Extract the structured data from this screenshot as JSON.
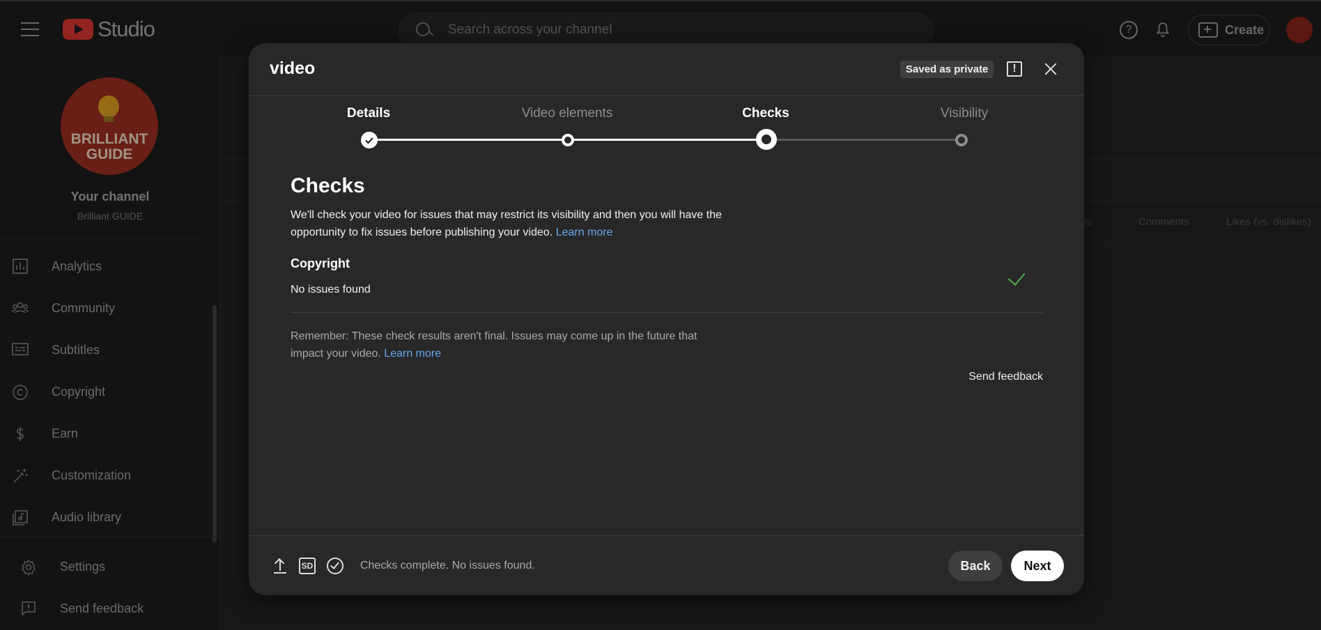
{
  "app": {
    "brand": "Studio",
    "search_placeholder": "Search across your channel",
    "create_label": "Create"
  },
  "sidebar": {
    "avatar_text": "BRILLIANT GUIDE",
    "your_channel": "Your channel",
    "channel_name": "Brilliant GUIDE",
    "items": [
      {
        "label": "Analytics",
        "icon": "analytics-icon"
      },
      {
        "label": "Community",
        "icon": "community-icon"
      },
      {
        "label": "Subtitles",
        "icon": "subtitles-icon"
      },
      {
        "label": "Copyright",
        "icon": "copyright-icon"
      },
      {
        "label": "Earn",
        "icon": "earn-icon"
      },
      {
        "label": "Customization",
        "icon": "customization-icon"
      },
      {
        "label": "Audio library",
        "icon": "audio-library-icon"
      }
    ],
    "settings_label": "Settings",
    "send_feedback_label": "Send feedback"
  },
  "background_columns": [
    "ews",
    "Comments",
    "Likes (vs. dislikes)"
  ],
  "dialog": {
    "title": "video",
    "saved_badge": "Saved as private",
    "steps": [
      {
        "label": "Details",
        "state": "done"
      },
      {
        "label": "Video elements",
        "state": "done"
      },
      {
        "label": "Checks",
        "state": "current"
      },
      {
        "label": "Visibility",
        "state": "todo"
      }
    ],
    "content_title": "Checks",
    "content_desc": "We'll check your video for issues that may restrict its visibility and then you will have the opportunity to fix issues before publishing your video.",
    "learn_more": "Learn more",
    "copyright_title": "Copyright",
    "copyright_status": "No issues found",
    "remember_text": "Remember: These check results aren't final. Issues may come up in the future that impact your video.",
    "send_feedback": "Send feedback",
    "footer_status": "Checks complete. No issues found.",
    "back_label": "Back",
    "next_label": "Next",
    "sd_label": "SD"
  },
  "colors": {
    "accent_link": "#65a8f0",
    "success_green": "#4fb04f",
    "brand_red": "#c4302b"
  }
}
